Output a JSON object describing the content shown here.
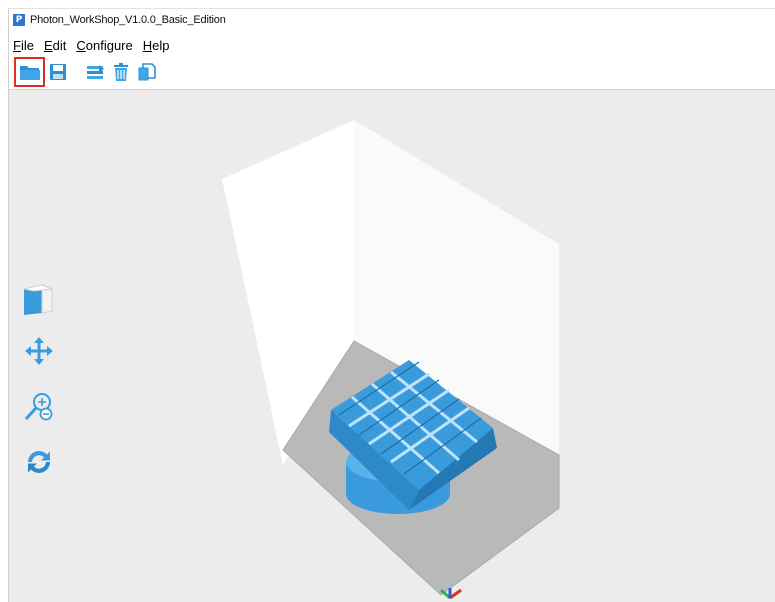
{
  "window": {
    "title": "Photon_WorkShop_V1.0.0_Basic_Edition",
    "app_icon_letter": "P"
  },
  "menu": [
    {
      "label": "File",
      "mnemonic": "F",
      "rest": "ile"
    },
    {
      "label": "Edit",
      "mnemonic": "E",
      "rest": "dit"
    },
    {
      "label": "Configure",
      "mnemonic": "C",
      "rest": "onfigure"
    },
    {
      "label": "Help",
      "mnemonic": "H",
      "rest": "elp"
    }
  ],
  "toolbar": {
    "icons": [
      "open-folder-icon",
      "save-icon",
      "slice-layers-icon",
      "delete-model-icon",
      "copy-model-icon"
    ],
    "highlighted": "open-folder-icon",
    "highlight_color": "#d9302a"
  },
  "view_tools": {
    "icons": [
      "view-cube-icon",
      "move-icon",
      "zoom-icon",
      "rotate-icon"
    ]
  },
  "colors": {
    "accent_blue": "#3a9bdc",
    "viewport_bg": "#ececec",
    "build_plate": "#b9b9b9"
  }
}
